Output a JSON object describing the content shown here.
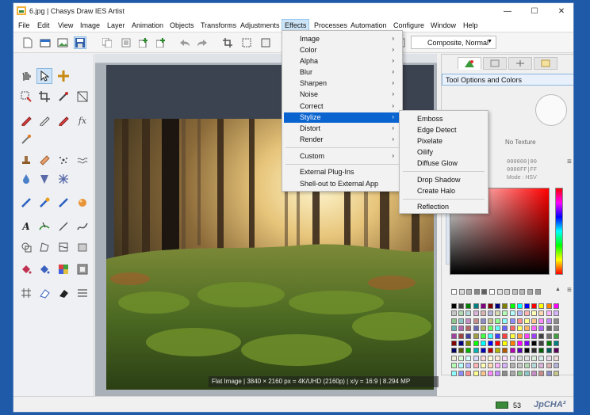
{
  "window": {
    "title": "6.jpg | Chasys Draw IES Artist",
    "controls": [
      "—",
      "☐",
      "✕"
    ]
  },
  "menubar": {
    "items": [
      "File",
      "Edit",
      "View",
      "Image",
      "Layer",
      "Animation",
      "Objects",
      "Transforms",
      "Adjustments",
      "Effects",
      "Processes",
      "Automation",
      "Configure",
      "Window",
      "Help"
    ],
    "active": "Effects"
  },
  "toolbar": {
    "mode_combo": "Composite, Normal"
  },
  "effects_menu": {
    "items": [
      "Image",
      "Color",
      "Alpha",
      "Blur",
      "Sharpen",
      "Noise",
      "Correct",
      "Stylize",
      "Distort",
      "Render",
      "Custom",
      "External Plug-Ins",
      "Shell-out to External App"
    ],
    "highlighted": "Stylize",
    "submenu_arrow": "›"
  },
  "stylize_submenu": {
    "items": [
      "Emboss",
      "Edge Detect",
      "Pixelate",
      "Oilify",
      "Diffuse Glow",
      "Drop Shadow",
      "Create Halo",
      "Reflection"
    ]
  },
  "right_panel": {
    "title": "Tool Options and Colors",
    "texture_label": "No Texture",
    "hex_1": "000000|00",
    "hex_2": "0000FF|FF",
    "color_mode": "Mode : HSV"
  },
  "canvas_status": "Flat Image | 3840 × 2160 px = 4K/UHD (2160p) | x/y = 16:9 | 8.294 MP",
  "statusbar": {
    "memory": "53",
    "watermark": "JpCHA²"
  },
  "colors": {
    "accent": "#0a64d0",
    "desktop": "#1e5aa8"
  }
}
